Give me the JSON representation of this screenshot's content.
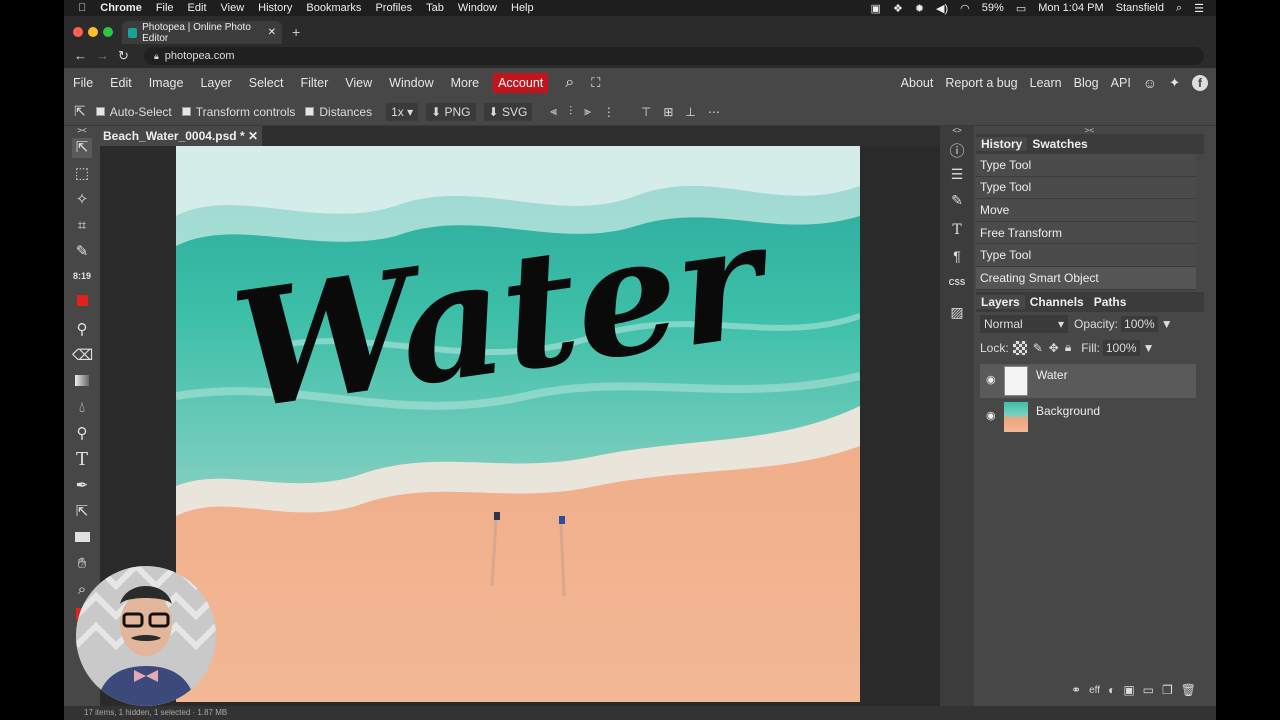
{
  "mac_menubar": {
    "app": "Chrome",
    "items": [
      "File",
      "Edit",
      "View",
      "History",
      "Bookmarks",
      "Profiles",
      "Tab",
      "Window",
      "Help"
    ],
    "battery": "59%",
    "clock": "Mon 1:04 PM",
    "user": "Stansfield"
  },
  "browser": {
    "tab_title": "Photopea | Online Photo Editor",
    "url": "photopea.com"
  },
  "menu": {
    "items": [
      "File",
      "Edit",
      "Image",
      "Layer",
      "Select",
      "Filter",
      "View",
      "Window",
      "More"
    ],
    "account": "Account",
    "right_items": [
      "About",
      "Report a bug",
      "Learn",
      "Blog",
      "API"
    ],
    "account_color": "#c3141d"
  },
  "options": {
    "auto_select": "Auto-Select",
    "transform_controls": "Transform controls",
    "distances": "Distances",
    "zoom": "1x",
    "png": "PNG",
    "svg": "SVG"
  },
  "document": {
    "tab_name": "Beach_Water_0004.psd *",
    "canvas_text": "Water"
  },
  "toolbar": {
    "time_label": "8:19"
  },
  "history_panel": {
    "tabs": [
      "History",
      "Swatches"
    ],
    "items": [
      "Type Tool",
      "Type Tool",
      "Move",
      "Free Transform",
      "Type Tool",
      "Creating Smart Object"
    ]
  },
  "layers_panel": {
    "tabs": [
      "Layers",
      "Channels",
      "Paths"
    ],
    "blend_mode": "Normal",
    "opacity_label": "Opacity:",
    "opacity_value": "100%",
    "lock_label": "Lock:",
    "fill_label": "Fill:",
    "fill_value": "100%",
    "layers": [
      {
        "name": "Water"
      },
      {
        "name": "Background"
      }
    ],
    "footer_eff": "eff"
  },
  "status_text": "17 items, 1 hidden, 1 selected · 1.87 MB"
}
